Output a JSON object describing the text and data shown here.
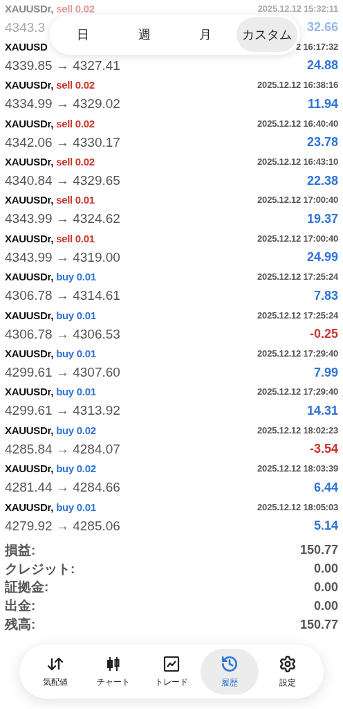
{
  "period_tabs": [
    {
      "label": "日",
      "selected": false
    },
    {
      "label": "週",
      "selected": false
    },
    {
      "label": "月",
      "selected": false
    },
    {
      "label": "カスタム",
      "selected": true
    }
  ],
  "trades": [
    {
      "symbol": "XAUUSDr,",
      "order": "sell 0.02",
      "kind": "sell",
      "time": "2025.12.12 15:32:11",
      "prices": "4343.3",
      "profit": "32.66",
      "loss": false,
      "faded": true
    },
    {
      "symbol": "XAUUSD",
      "time": "2 16:17:32",
      "prices": "4339.85 → 4327.41",
      "profit": "24.88",
      "loss": false,
      "faded": false
    },
    {
      "symbol": "XAUUSDr,",
      "order": "sell 0.02",
      "kind": "sell",
      "time": "2025.12.12 16:38:16",
      "prices": "4334.99 → 4329.02",
      "profit": "11.94",
      "loss": false,
      "faded": false
    },
    {
      "symbol": "XAUUSDr,",
      "order": "sell 0.02",
      "kind": "sell",
      "time": "2025.12.12 16:40:40",
      "prices": "4342.06 → 4330.17",
      "profit": "23.78",
      "loss": false,
      "faded": false
    },
    {
      "symbol": "XAUUSDr,",
      "order": "sell 0.02",
      "kind": "sell",
      "time": "2025.12.12 16:43:10",
      "prices": "4340.84 → 4329.65",
      "profit": "22.38",
      "loss": false,
      "faded": false
    },
    {
      "symbol": "XAUUSDr,",
      "order": "sell 0.01",
      "kind": "sell",
      "time": "2025.12.12 17:00:40",
      "prices": "4343.99 → 4324.62",
      "profit": "19.37",
      "loss": false,
      "faded": false
    },
    {
      "symbol": "XAUUSDr,",
      "order": "sell 0.01",
      "kind": "sell",
      "time": "2025.12.12 17:00:40",
      "prices": "4343.99 → 4319.00",
      "profit": "24.99",
      "loss": false,
      "faded": false
    },
    {
      "symbol": "XAUUSDr,",
      "order": "buy 0.01",
      "kind": "buy",
      "time": "2025.12.12 17:25:24",
      "prices": "4306.78 → 4314.61",
      "profit": "7.83",
      "loss": false,
      "faded": false
    },
    {
      "symbol": "XAUUSDr,",
      "order": "buy 0.01",
      "kind": "buy",
      "time": "2025.12.12 17:25:24",
      "prices": "4306.78 → 4306.53",
      "profit": "-0.25",
      "loss": true,
      "faded": false
    },
    {
      "symbol": "XAUUSDr,",
      "order": "buy 0.01",
      "kind": "buy",
      "time": "2025.12.12 17:29:40",
      "prices": "4299.61 → 4307.60",
      "profit": "7.99",
      "loss": false,
      "faded": false
    },
    {
      "symbol": "XAUUSDr,",
      "order": "buy 0.01",
      "kind": "buy",
      "time": "2025.12.12 17:29:40",
      "prices": "4299.61 → 4313.92",
      "profit": "14.31",
      "loss": false,
      "faded": false
    },
    {
      "symbol": "XAUUSDr,",
      "order": "buy 0.02",
      "kind": "buy",
      "time": "2025.12.12 18:02:23",
      "prices": "4285.84 → 4284.07",
      "profit": "-3.54",
      "loss": true,
      "faded": false
    },
    {
      "symbol": "XAUUSDr,",
      "order": "buy 0.02",
      "kind": "buy",
      "time": "2025.12.12 18:03:39",
      "prices": "4281.44 → 4284.66",
      "profit": "6.44",
      "loss": false,
      "faded": false
    },
    {
      "symbol": "XAUUSDr,",
      "order": "buy 0.01",
      "kind": "buy",
      "time": "2025.12.12 18:05:03",
      "prices": "4279.92 → 4285.06",
      "profit": "5.14",
      "loss": false,
      "faded": false
    }
  ],
  "summary": [
    {
      "label": "損益:",
      "value": "150.77"
    },
    {
      "label": "クレジット:",
      "value": "0.00"
    },
    {
      "label": "証拠金:",
      "value": "0.00"
    },
    {
      "label": "出金:",
      "value": "0.00"
    },
    {
      "label": "残高:",
      "value": "150.77"
    }
  ],
  "nav": [
    {
      "kind": "quotes",
      "label": "気配値",
      "selected": false
    },
    {
      "kind": "chart",
      "label": "チャート",
      "selected": false
    },
    {
      "kind": "trade",
      "label": "トレード",
      "selected": false
    },
    {
      "kind": "history",
      "label": "履歴",
      "selected": true
    },
    {
      "kind": "settings",
      "label": "設定",
      "selected": false
    }
  ]
}
